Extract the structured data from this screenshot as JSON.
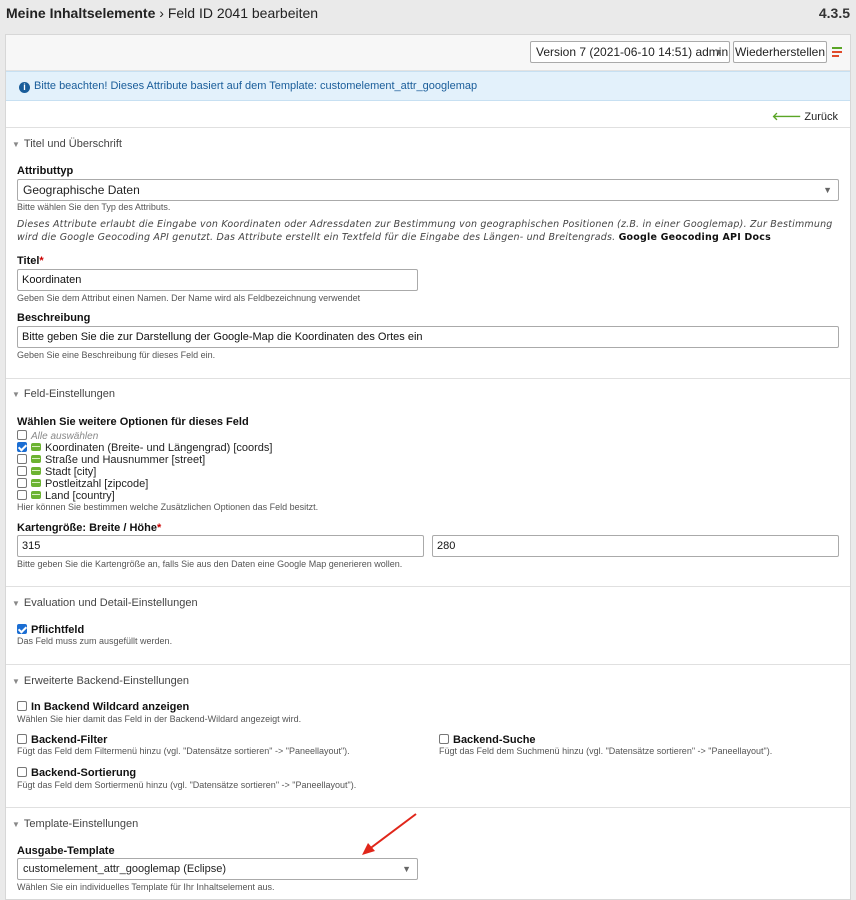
{
  "header": {
    "crumb_root": "Meine Inhaltselemente",
    "crumb_sep": "›",
    "crumb_current": "Feld ID 2041 bearbeiten",
    "version": "4.3.5"
  },
  "versionbar": {
    "version_select": "Version 7 (2021-06-10 14:51) admin",
    "restore_button": "Wiederherstellen"
  },
  "info": {
    "text": "Bitte beachten! Dieses Attribute basiert auf dem Template: customelement_attr_googlemap"
  },
  "back": {
    "label": "Zurück"
  },
  "sections": {
    "title": "Titel und Überschrift",
    "field": "Feld-Einstellungen",
    "eval": "Evaluation und Detail-Einstellungen",
    "backend": "Erweiterte Backend-Einstellungen",
    "template": "Template-Einstellungen"
  },
  "attrtype": {
    "label": "Attributtyp",
    "value": "Geographische Daten",
    "help": "Bitte wählen Sie den Typ des Attributs."
  },
  "description_text": {
    "text": "Dieses Attribute erlaubt die Eingabe von Koordinaten oder Adressdaten zur Bestimmung von geographischen Positionen (z.B. in einer Googlemap). Zur Bestimmung wird die Google Geocoding API genutzt. Das Attribute erstellt ein Textfeld für die Eingabe des Längen- und Breitengrads.",
    "link": "Google Geocoding API Docs"
  },
  "titel": {
    "label": "Titel",
    "required": "*",
    "value": "Koordinaten",
    "help": "Geben Sie dem Attribut einen Namen. Der Name wird als Feldbezeichnung verwendet"
  },
  "beschreibung": {
    "label": "Beschreibung",
    "value": "Bitte geben Sie die zur Darstellung der Google-Map die Koordinaten des Ortes ein",
    "help": "Geben Sie eine Beschreibung für dieses Feld ein."
  },
  "options": {
    "label": "Wählen Sie weitere Optionen für dieses Feld",
    "select_all": "Alle auswählen",
    "items": [
      {
        "label": "Koordinaten (Breite- und Längengrad) [coords]",
        "checked": true
      },
      {
        "label": "Straße und Hausnummer [street]",
        "checked": false
      },
      {
        "label": "Stadt [city]",
        "checked": false
      },
      {
        "label": "Postleitzahl [zipcode]",
        "checked": false
      },
      {
        "label": "Land [country]",
        "checked": false
      }
    ],
    "help": "Hier können Sie bestimmen welche Zusätzlichen Optionen das Feld besitzt."
  },
  "mapsize": {
    "label": "Kartengröße: Breite / Höhe",
    "required": "*",
    "width": "315",
    "height": "280",
    "help": "Bitte geben Sie die Kartengröße an, falls Sie aus den Daten eine Google Map generieren wollen."
  },
  "pflichtfeld": {
    "label": "Pflichtfeld",
    "checked": true,
    "help": "Das Feld muss zum ausgefüllt werden."
  },
  "wildcard": {
    "label": "In Backend Wildcard anzeigen",
    "checked": false,
    "help": "Wählen Sie hier damit das Feld in der Backend-Wildard angezeigt wird."
  },
  "bfilter": {
    "label": "Backend-Filter",
    "checked": false,
    "help": "Fügt das Feld dem Filtermenü hinzu (vgl. \"Datensätze sortieren\" -> \"Paneellayout\")."
  },
  "bsuche": {
    "label": "Backend-Suche",
    "checked": false,
    "help": "Fügt das Feld dem Suchmenü hinzu (vgl. \"Datensätze sortieren\" -> \"Paneellayout\")."
  },
  "bsort": {
    "label": "Backend-Sortierung",
    "checked": false,
    "help": "Fügt das Feld dem Sortiermenü hinzu (vgl. \"Datensätze sortieren\" -> \"Paneellayout\")."
  },
  "ausgabe": {
    "label": "Ausgabe-Template",
    "value": "customelement_attr_googlemap (Eclipse)",
    "help": "Wählen Sie ein individuelles Template für Ihr Inhaltselement aus."
  },
  "colors": {
    "accent": "#1b6ed3",
    "info_bg": "#e3f1fb",
    "annotation_arrow": "#e0261a"
  }
}
